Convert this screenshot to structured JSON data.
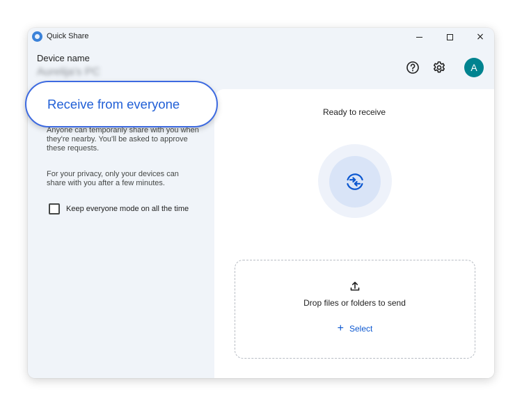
{
  "window": {
    "title": "Quick Share",
    "controls": {
      "minimize": "minimize",
      "maximize": "maximize",
      "close": "×"
    }
  },
  "header": {
    "device_label": "Device name",
    "device_value": "Aurelija's PC",
    "avatar_initial": "A",
    "icons": [
      "help-icon",
      "gear-icon"
    ]
  },
  "left_panel": {
    "mode_title": "Receive from everyone",
    "description_1": "Anyone can temporarily share with you when they're nearby. You'll be asked to approve these requests.",
    "description_2": "For your privacy, only your devices can share with you after a few minutes.",
    "checkbox_label": "Keep everyone mode on all the time",
    "checkbox_checked": false
  },
  "right_panel": {
    "status": "Ready to receive",
    "drop_text": "Drop files or folders to send",
    "select_label": "Select"
  },
  "colors": {
    "accent": "#0b57d0",
    "highlight_border": "#3d6ae0",
    "avatar": "#00838f",
    "window_bg": "#f0f4f9"
  }
}
